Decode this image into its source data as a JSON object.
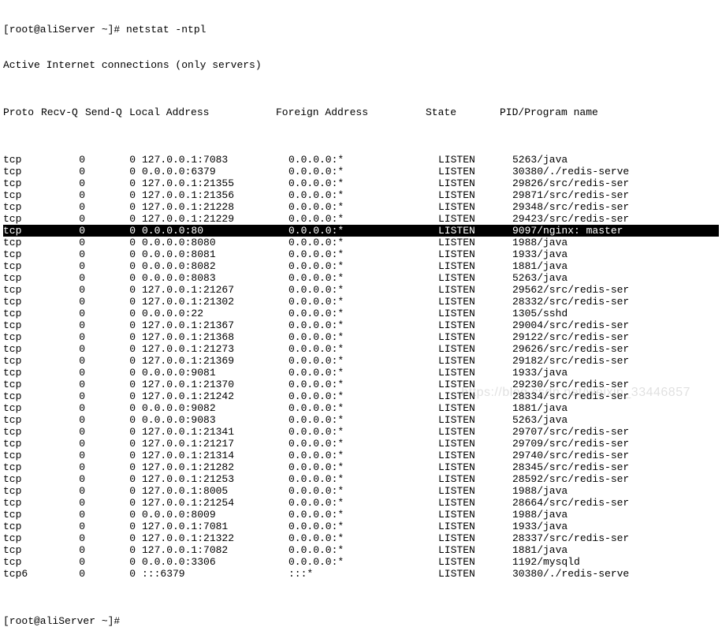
{
  "pre_lines": {
    "l0": "[root@aliServer ~]# netstat -ntpl",
    "l1": "Active Internet connections (only servers)"
  },
  "header": {
    "proto": "Proto",
    "recvq": "Recv-Q",
    "sendq": "Send-Q",
    "local": "Local Address",
    "foreign": "Foreign Address",
    "state": "State",
    "pid": "PID/Program name"
  },
  "rows": [
    {
      "proto": "tcp",
      "recv": "0",
      "send": "0",
      "local": "127.0.0.1:7083",
      "foreign": "0.0.0.0:*",
      "state": "LISTEN",
      "pid": "5263/java",
      "hl": false
    },
    {
      "proto": "tcp",
      "recv": "0",
      "send": "0",
      "local": "0.0.0.0:6379",
      "foreign": "0.0.0.0:*",
      "state": "LISTEN",
      "pid": "30380/./redis-serve",
      "hl": false
    },
    {
      "proto": "tcp",
      "recv": "0",
      "send": "0",
      "local": "127.0.0.1:21355",
      "foreign": "0.0.0.0:*",
      "state": "LISTEN",
      "pid": "29826/src/redis-ser",
      "hl": false
    },
    {
      "proto": "tcp",
      "recv": "0",
      "send": "0",
      "local": "127.0.0.1:21356",
      "foreign": "0.0.0.0:*",
      "state": "LISTEN",
      "pid": "29871/src/redis-ser",
      "hl": false
    },
    {
      "proto": "tcp",
      "recv": "0",
      "send": "0",
      "local": "127.0.0.1:21228",
      "foreign": "0.0.0.0:*",
      "state": "LISTEN",
      "pid": "29348/src/redis-ser",
      "hl": false
    },
    {
      "proto": "tcp",
      "recv": "0",
      "send": "0",
      "local": "127.0.0.1:21229",
      "foreign": "0.0.0.0:*",
      "state": "LISTEN",
      "pid": "29423/src/redis-ser",
      "hl": false
    },
    {
      "proto": "tcp",
      "recv": "0",
      "send": "0",
      "local": "0.0.0.0:80",
      "foreign": "0.0.0.0:*",
      "state": "LISTEN",
      "pid": "9097/nginx: master",
      "hl": true
    },
    {
      "proto": "tcp",
      "recv": "0",
      "send": "0",
      "local": "0.0.0.0:8080",
      "foreign": "0.0.0.0:*",
      "state": "LISTEN",
      "pid": "1988/java",
      "hl": false
    },
    {
      "proto": "tcp",
      "recv": "0",
      "send": "0",
      "local": "0.0.0.0:8081",
      "foreign": "0.0.0.0:*",
      "state": "LISTEN",
      "pid": "1933/java",
      "hl": false
    },
    {
      "proto": "tcp",
      "recv": "0",
      "send": "0",
      "local": "0.0.0.0:8082",
      "foreign": "0.0.0.0:*",
      "state": "LISTEN",
      "pid": "1881/java",
      "hl": false
    },
    {
      "proto": "tcp",
      "recv": "0",
      "send": "0",
      "local": "0.0.0.0:8083",
      "foreign": "0.0.0.0:*",
      "state": "LISTEN",
      "pid": "5263/java",
      "hl": false
    },
    {
      "proto": "tcp",
      "recv": "0",
      "send": "0",
      "local": "127.0.0.1:21267",
      "foreign": "0.0.0.0:*",
      "state": "LISTEN",
      "pid": "29562/src/redis-ser",
      "hl": false
    },
    {
      "proto": "tcp",
      "recv": "0",
      "send": "0",
      "local": "127.0.0.1:21302",
      "foreign": "0.0.0.0:*",
      "state": "LISTEN",
      "pid": "28332/src/redis-ser",
      "hl": false
    },
    {
      "proto": "tcp",
      "recv": "0",
      "send": "0",
      "local": "0.0.0.0:22",
      "foreign": "0.0.0.0:*",
      "state": "LISTEN",
      "pid": "1305/sshd",
      "hl": false
    },
    {
      "proto": "tcp",
      "recv": "0",
      "send": "0",
      "local": "127.0.0.1:21367",
      "foreign": "0.0.0.0:*",
      "state": "LISTEN",
      "pid": "29004/src/redis-ser",
      "hl": false
    },
    {
      "proto": "tcp",
      "recv": "0",
      "send": "0",
      "local": "127.0.0.1:21368",
      "foreign": "0.0.0.0:*",
      "state": "LISTEN",
      "pid": "29122/src/redis-ser",
      "hl": false
    },
    {
      "proto": "tcp",
      "recv": "0",
      "send": "0",
      "local": "127.0.0.1:21273",
      "foreign": "0.0.0.0:*",
      "state": "LISTEN",
      "pid": "29626/src/redis-ser",
      "hl": false
    },
    {
      "proto": "tcp",
      "recv": "0",
      "send": "0",
      "local": "127.0.0.1:21369",
      "foreign": "0.0.0.0:*",
      "state": "LISTEN",
      "pid": "29182/src/redis-ser",
      "hl": false
    },
    {
      "proto": "tcp",
      "recv": "0",
      "send": "0",
      "local": "0.0.0.0:9081",
      "foreign": "0.0.0.0:*",
      "state": "LISTEN",
      "pid": "1933/java",
      "hl": false
    },
    {
      "proto": "tcp",
      "recv": "0",
      "send": "0",
      "local": "127.0.0.1:21370",
      "foreign": "0.0.0.0:*",
      "state": "LISTEN",
      "pid": "29230/src/redis-ser",
      "hl": false
    },
    {
      "proto": "tcp",
      "recv": "0",
      "send": "0",
      "local": "127.0.0.1:21242",
      "foreign": "0.0.0.0:*",
      "state": "LISTEN",
      "pid": "28334/src/redis-ser",
      "hl": false
    },
    {
      "proto": "tcp",
      "recv": "0",
      "send": "0",
      "local": "0.0.0.0:9082",
      "foreign": "0.0.0.0:*",
      "state": "LISTEN",
      "pid": "1881/java",
      "hl": false
    },
    {
      "proto": "tcp",
      "recv": "0",
      "send": "0",
      "local": "0.0.0.0:9083",
      "foreign": "0.0.0.0:*",
      "state": "LISTEN",
      "pid": "5263/java",
      "hl": false
    },
    {
      "proto": "tcp",
      "recv": "0",
      "send": "0",
      "local": "127.0.0.1:21341",
      "foreign": "0.0.0.0:*",
      "state": "LISTEN",
      "pid": "29707/src/redis-ser",
      "hl": false
    },
    {
      "proto": "tcp",
      "recv": "0",
      "send": "0",
      "local": "127.0.0.1:21217",
      "foreign": "0.0.0.0:*",
      "state": "LISTEN",
      "pid": "29709/src/redis-ser",
      "hl": false
    },
    {
      "proto": "tcp",
      "recv": "0",
      "send": "0",
      "local": "127.0.0.1:21314",
      "foreign": "0.0.0.0:*",
      "state": "LISTEN",
      "pid": "29740/src/redis-ser",
      "hl": false
    },
    {
      "proto": "tcp",
      "recv": "0",
      "send": "0",
      "local": "127.0.0.1:21282",
      "foreign": "0.0.0.0:*",
      "state": "LISTEN",
      "pid": "28345/src/redis-ser",
      "hl": false
    },
    {
      "proto": "tcp",
      "recv": "0",
      "send": "0",
      "local": "127.0.0.1:21253",
      "foreign": "0.0.0.0:*",
      "state": "LISTEN",
      "pid": "28592/src/redis-ser",
      "hl": false
    },
    {
      "proto": "tcp",
      "recv": "0",
      "send": "0",
      "local": "127.0.0.1:8005",
      "foreign": "0.0.0.0:*",
      "state": "LISTEN",
      "pid": "1988/java",
      "hl": false
    },
    {
      "proto": "tcp",
      "recv": "0",
      "send": "0",
      "local": "127.0.0.1:21254",
      "foreign": "0.0.0.0:*",
      "state": "LISTEN",
      "pid": "28664/src/redis-ser",
      "hl": false
    },
    {
      "proto": "tcp",
      "recv": "0",
      "send": "0",
      "local": "0.0.0.0:8009",
      "foreign": "0.0.0.0:*",
      "state": "LISTEN",
      "pid": "1988/java",
      "hl": false
    },
    {
      "proto": "tcp",
      "recv": "0",
      "send": "0",
      "local": "127.0.0.1:7081",
      "foreign": "0.0.0.0:*",
      "state": "LISTEN",
      "pid": "1933/java",
      "hl": false
    },
    {
      "proto": "tcp",
      "recv": "0",
      "send": "0",
      "local": "127.0.0.1:21322",
      "foreign": "0.0.0.0:*",
      "state": "LISTEN",
      "pid": "28337/src/redis-ser",
      "hl": false
    },
    {
      "proto": "tcp",
      "recv": "0",
      "send": "0",
      "local": "127.0.0.1:7082",
      "foreign": "0.0.0.0:*",
      "state": "LISTEN",
      "pid": "1881/java",
      "hl": false
    },
    {
      "proto": "tcp",
      "recv": "0",
      "send": "0",
      "local": "0.0.0.0:3306",
      "foreign": "0.0.0.0:*",
      "state": "LISTEN",
      "pid": "1192/mysqld",
      "hl": false
    },
    {
      "proto": "tcp6",
      "recv": "0",
      "send": "0",
      "local": ":::6379",
      "foreign": ":::*",
      "state": "LISTEN",
      "pid": "30380/./redis-serve",
      "hl": false
    }
  ],
  "post_lines": {
    "l0": "[root@aliServer ~]#"
  },
  "watermark": "https://blog.csdn.net/weixin_33446857"
}
